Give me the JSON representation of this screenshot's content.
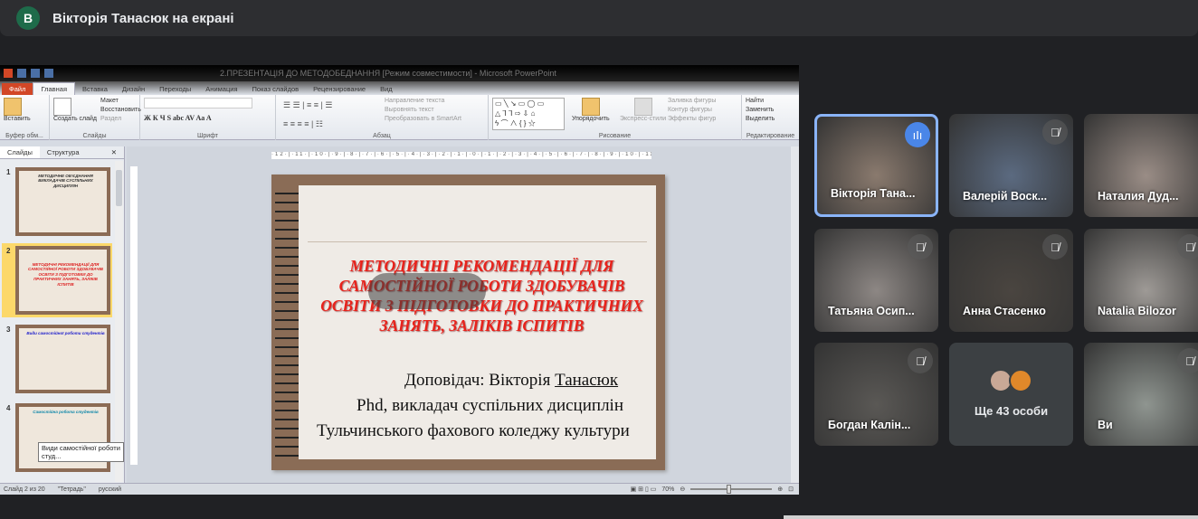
{
  "meet": {
    "presenter_initial": "В",
    "title": "Вікторія Танасюк на екрані",
    "participants": [
      {
        "name": "Вікторія Тана...",
        "muted": false,
        "speaking": true,
        "bg": "#8a7a6e"
      },
      {
        "name": "Валерій Воск...",
        "muted": true,
        "speaking": false,
        "bg": "#5b6a80"
      },
      {
        "name": "Наталия Дуд...",
        "muted": false,
        "speaking": false,
        "bg": "#9a8d86"
      },
      {
        "name": "Татьяна Осип...",
        "muted": true,
        "speaking": false,
        "bg": "#8d8784"
      },
      {
        "name": "Анна Стасенко",
        "muted": true,
        "speaking": false,
        "bg": "#4a4540"
      },
      {
        "name": "Natalia Bilozor",
        "muted": true,
        "speaking": false,
        "bg": "#9e9a96"
      },
      {
        "name": "Богдан Калін...",
        "muted": true,
        "speaking": false,
        "bg": "#5a5855"
      },
      {
        "name": "Ви",
        "muted": true,
        "speaking": false,
        "bg": "#8f9590"
      }
    ],
    "more_label": "Ще 43 особи"
  },
  "ppt": {
    "window_title": "2.ПРЕЗЕНТАЦІЯ ДО МЕТОДОБЕДНАННЯ [Режим совместимости] - Microsoft PowerPoint",
    "tabs": [
      "Файл",
      "Главная",
      "Вставка",
      "Дизайн",
      "Переходы",
      "Анимация",
      "Показ слайдов",
      "Рецензирование",
      "Вид"
    ],
    "ribbon": {
      "paste": "Вставить",
      "clipboard": "Буфер обм...",
      "new_slide": "Создать слайд",
      "layout": "Макет",
      "reset": "Восстановить",
      "section": "Раздел",
      "slides_group": "Слайды",
      "font_group": "Шрифт",
      "text_dir": "Направление текста",
      "align_text": "Выровнять текст",
      "smartart": "Преобразовать в SmartArt",
      "paragraph_group": "Абзац",
      "arrange": "Упорядочить",
      "quick_styles": "Экспресс-стили",
      "shape_fill": "Заливка фигуры",
      "shape_outline": "Контур фигуры",
      "shape_effects": "Эффекты фигур",
      "drawing_group": "Рисование",
      "find": "Найти",
      "replace": "Заменить",
      "select": "Выделить",
      "editing_group": "Редактирование"
    },
    "panel_tabs": [
      "Слайды",
      "Структура"
    ],
    "thumbnails": [
      {
        "num": "1",
        "title": "МЕТОДИЧНЕ ОБ'ЄДНАННЯ ВИКЛАДАЧІВ СУСПІЛЬНИХ ДИСЦИПЛІН"
      },
      {
        "num": "2",
        "title": "МЕТОДИЧНІ РЕКОМЕНДАЦІЇ ДЛЯ САМОСТІЙНОЇ РОБОТИ ЗДОБУВАЧІВ ОСВІТИ З ПІДГОТОВКИ ДО ПРАКТИЧНИХ ЗАНЯТЬ, ЗАЛІКІВ ІСПИТІВ"
      },
      {
        "num": "3",
        "title": "Види самостійної роботи студентів"
      },
      {
        "num": "4",
        "title": "Самостійна робота студентів"
      }
    ],
    "tooltip": "Види самостійної роботи студ...",
    "ruler": "·12·|·11·|·10·|·9·|·8·|·7·|·6·|·5·|·4·|·3·|·2·|·1·|·0·|·1·|·2·|·3·|·4·|·5·|·6·|·7·|·8·|·9·|·10·|·11·|·12·",
    "slide": {
      "title": "МЕТОДИЧНІ РЕКОМЕНДАЦІЇ ДЛЯ САМОСТІЙНОЇ РОБОТИ ЗДОБУВАЧІВ ОСВІТИ З ПІДГОТОВКИ ДО ПРАКТИЧНИХ ЗАНЯТЬ, ЗАЛІКІВ ІСПИТІВ",
      "speaker_label": "Доповідач: Вікторія ",
      "speaker_surname": "Танасюк",
      "position": "Phd,  викладач суспільних дисциплін",
      "institution": "Тульчинського фахового коледжу культури"
    },
    "status": {
      "slide": "Слайд 2 из 20",
      "theme": "\"Тетрадь\"",
      "lang": "русский",
      "zoom": "70%"
    }
  }
}
